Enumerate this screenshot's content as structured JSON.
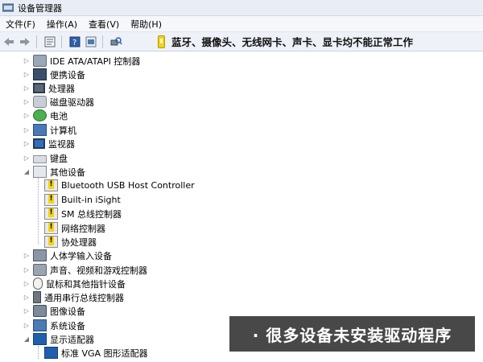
{
  "window": {
    "title": "设备管理器"
  },
  "menu": [
    "文件(F)",
    "操作(A)",
    "查看(V)",
    "帮助(H)"
  ],
  "toolbar": {
    "icons": [
      "back-arrow-icon",
      "forward-arrow-icon",
      "properties-icon",
      "help-icon",
      "scan-hardware-icon"
    ]
  },
  "banner": {
    "text": "蓝牙、摄像头、无线网卡、声卡、显卡均不能正常工作",
    "color": "#f2d21c"
  },
  "tree": {
    "categories": [
      {
        "label": "IDE ATA/ATAPI 控制器",
        "icon": "disk-controller-icon"
      },
      {
        "label": "便携设备",
        "icon": "portable-device-icon"
      },
      {
        "label": "处理器",
        "icon": "processor-icon"
      },
      {
        "label": "磁盘驱动器",
        "icon": "disk-drive-icon"
      },
      {
        "label": "电池",
        "icon": "battery-icon"
      },
      {
        "label": "计算机",
        "icon": "computer-icon"
      },
      {
        "label": "监视器",
        "icon": "monitor-icon"
      },
      {
        "label": "键盘",
        "icon": "keyboard-icon"
      },
      {
        "label": "其他设备",
        "icon": "other-devices-icon",
        "expanded": true
      },
      {
        "label": "人体学输入设备",
        "icon": "hid-icon"
      },
      {
        "label": "声音、视频和游戏控制器",
        "icon": "sound-icon"
      },
      {
        "label": "鼠标和其他指针设备",
        "icon": "mouse-icon"
      },
      {
        "label": "通用串行总线控制器",
        "icon": "usb-icon"
      },
      {
        "label": "图像设备",
        "icon": "imaging-icon"
      },
      {
        "label": "系统设备",
        "icon": "system-icon"
      },
      {
        "label": "显示适配器",
        "icon": "display-adapter-icon",
        "expanded": true
      }
    ],
    "other_devices": [
      {
        "label": "Bluetooth USB Host Controller",
        "icon": "warning-device-icon"
      },
      {
        "label": "Built-in iSight",
        "icon": "warning-device-icon"
      },
      {
        "label": "SM 总线控制器",
        "icon": "warning-device-icon"
      },
      {
        "label": "网络控制器",
        "icon": "warning-device-icon"
      },
      {
        "label": "协处理器",
        "icon": "warning-device-icon"
      }
    ],
    "display_adapters": [
      {
        "label": "标准 VGA 图形适配器",
        "icon": "display-adapter-icon"
      }
    ]
  },
  "caption": {
    "text": "· 很多设备未安装驱动程序"
  }
}
